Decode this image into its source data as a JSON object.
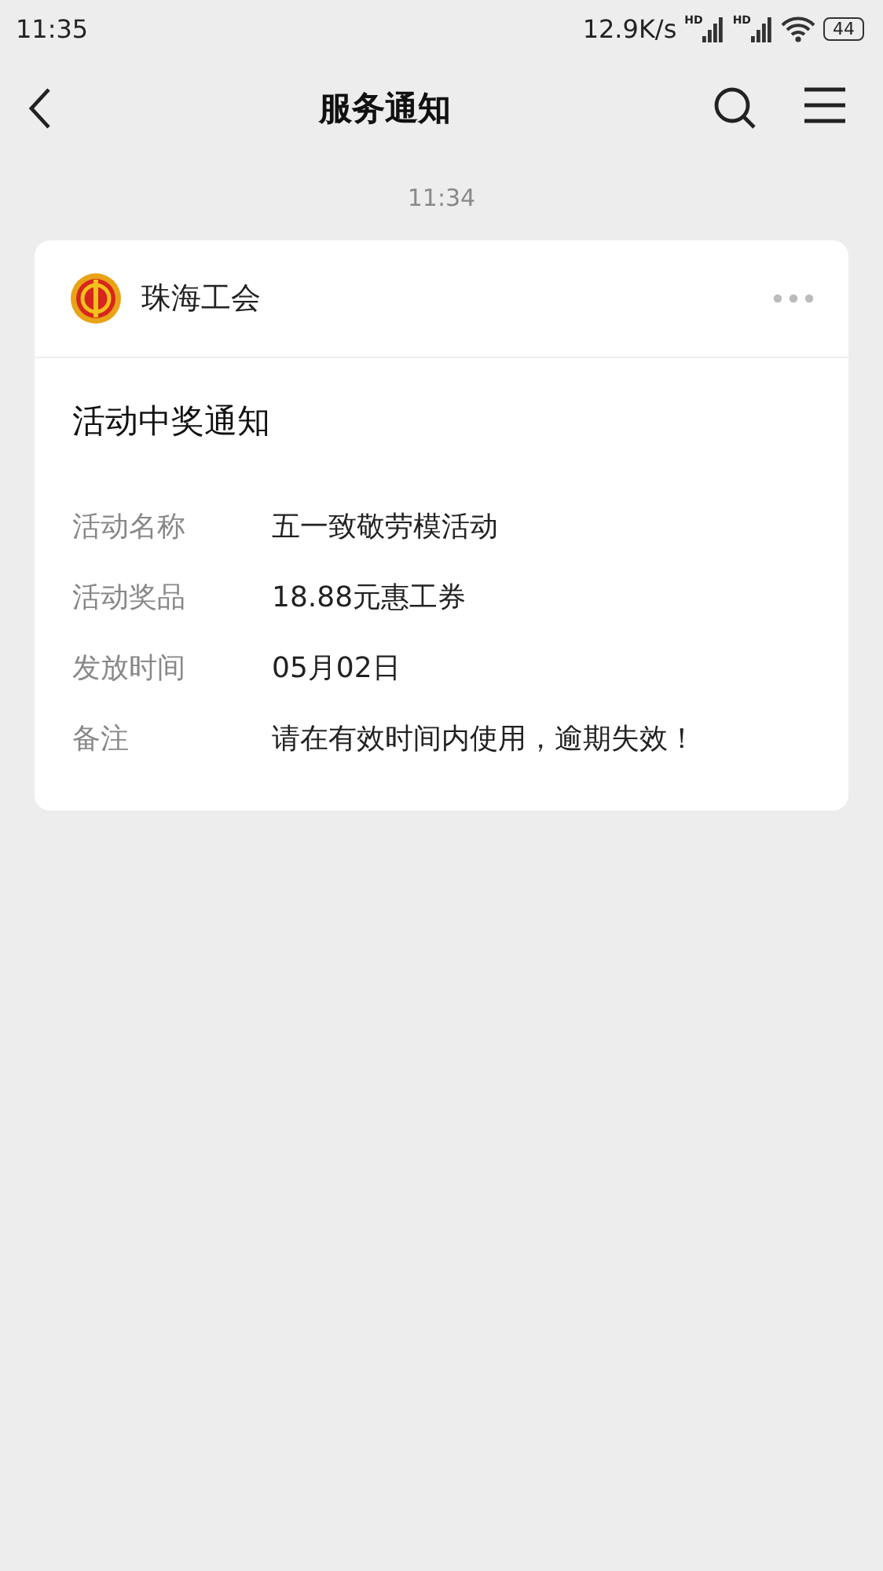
{
  "status_bar": {
    "time": "11:35",
    "speed": "12.9K/s",
    "signals": [
      {
        "badge": "HD"
      },
      {
        "badge": "HD"
      }
    ],
    "battery": "44"
  },
  "nav": {
    "title": "服务通知"
  },
  "timestamp": "11:34",
  "card": {
    "sender": "珠海工会",
    "title": "活动中奖通知",
    "fields": [
      {
        "label": "活动名称",
        "value": "五一致敬劳模活动"
      },
      {
        "label": "活动奖品",
        "value": "18.88元惠工券"
      },
      {
        "label": "发放时间",
        "value": "05月02日"
      },
      {
        "label": "备注",
        "value": "请在有效时间内使用，逾期失效！"
      }
    ]
  }
}
